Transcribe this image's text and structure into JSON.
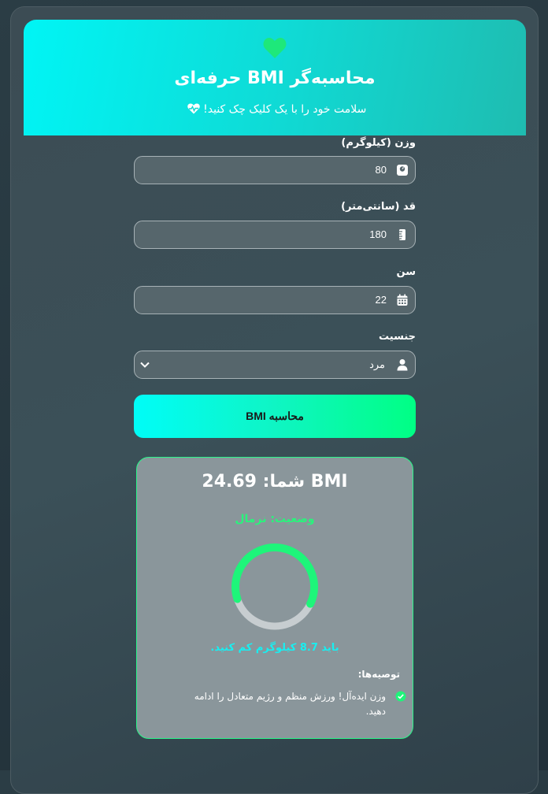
{
  "header": {
    "title": "محاسبه‌گر BMI حرفه‌ای",
    "subtitle": "سلامت خود را با یک کلیک چک کنید!",
    "heart_color": "#1ee87a"
  },
  "form": {
    "weight": {
      "label": "وزن (کیلوگرم)",
      "value": "80",
      "icon": "weight-scale-icon"
    },
    "height": {
      "label": "قد (سانتی‌متر)",
      "value": "180",
      "icon": "ruler-icon"
    },
    "age": {
      "label": "سن",
      "value": "22",
      "icon": "calendar-icon"
    },
    "gender": {
      "label": "جنسیت",
      "value": "مرد",
      "icon": "user-icon"
    },
    "submit_label": "محاسبه BMI"
  },
  "result": {
    "bmi_text": "BMI شما: 24.69",
    "bmi_value": 24.69,
    "status_text": "وضعیت: نرمال",
    "gauge_fraction": 0.62,
    "advice": "باید 8.7 کیلوگرم کم کنید.",
    "recommendations_title": "توصیه‌ها:",
    "recommendations": [
      "وزن ایده‌آل! ورزش منظم و رژیم متعادل را ادامه دهید."
    ]
  },
  "colors": {
    "accent_green": "#1ef57a",
    "accent_cyan": "#00f5f5"
  }
}
